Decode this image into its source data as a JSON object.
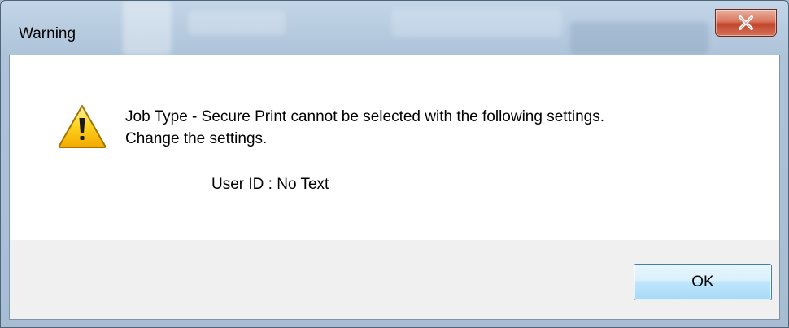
{
  "dialog": {
    "title": "Warning",
    "close_icon": "close-x-icon",
    "icon": "warning-triangle-icon",
    "message_line1": "Job Type - Secure Print cannot be selected with the following settings.",
    "message_line2": "Change the settings.",
    "detail": "User ID : No Text",
    "ok_label": "OK"
  },
  "colors": {
    "close_button": "#c7462c",
    "ok_border": "#3c7fb1",
    "content_bg": "#ffffff",
    "footer_bg": "#f0f0f0"
  }
}
